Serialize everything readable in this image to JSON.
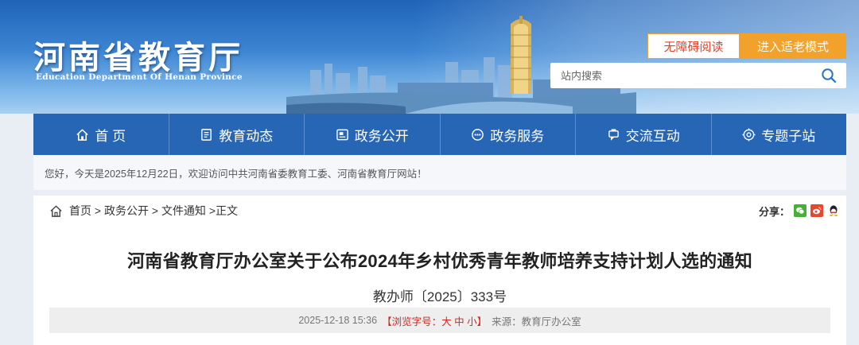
{
  "header": {
    "logo_cn": "河南省教育厅",
    "logo_en": "Education Department Of Henan Province",
    "accessible_label": "无障碍阅读",
    "elder_mode_label": "进入适老模式",
    "search": {
      "placeholder": "站内搜索",
      "value": ""
    }
  },
  "nav": {
    "items": [
      {
        "label": "首 页",
        "icon": "home-icon"
      },
      {
        "label": "教育动态",
        "icon": "news-icon"
      },
      {
        "label": "政务公开",
        "icon": "gov-open-icon"
      },
      {
        "label": "政务服务",
        "icon": "service-icon"
      },
      {
        "label": "交流互动",
        "icon": "interaction-icon"
      },
      {
        "label": "专题子站",
        "icon": "subsite-icon"
      }
    ]
  },
  "welcome": {
    "text": "您好，今天是2025年12月22日，欢迎访问中共河南省委教育工委、河南省教育厅网站！"
  },
  "breadcrumb": {
    "home": "首页",
    "sep1": " > ",
    "level1": "政务公开",
    "sep2": " > ",
    "level2": "文件通知",
    "sep3": " >",
    "current": "正文"
  },
  "share": {
    "label": "分享：",
    "targets": [
      "wechat-icon",
      "weibo-icon",
      "qq-icon"
    ]
  },
  "article": {
    "title": "河南省教育厅办公室关于公布2024年乡村优秀青年教师培养支持计划人选的通知",
    "doc_number": "教办师〔2025〕333号",
    "meta": {
      "datetime": "2025-12-18 15:36",
      "fontsize_open": "【浏览字号：",
      "size_large": "大",
      "size_medium": "中",
      "size_small": "小",
      "fontsize_close": "】",
      "source": "来源：教育厅办公室"
    }
  },
  "colors": {
    "nav_bg": "#2766b4",
    "accent_orange": "#f2a12b",
    "accessible_text": "#e0442e",
    "fontsize_red": "#d3271f"
  }
}
